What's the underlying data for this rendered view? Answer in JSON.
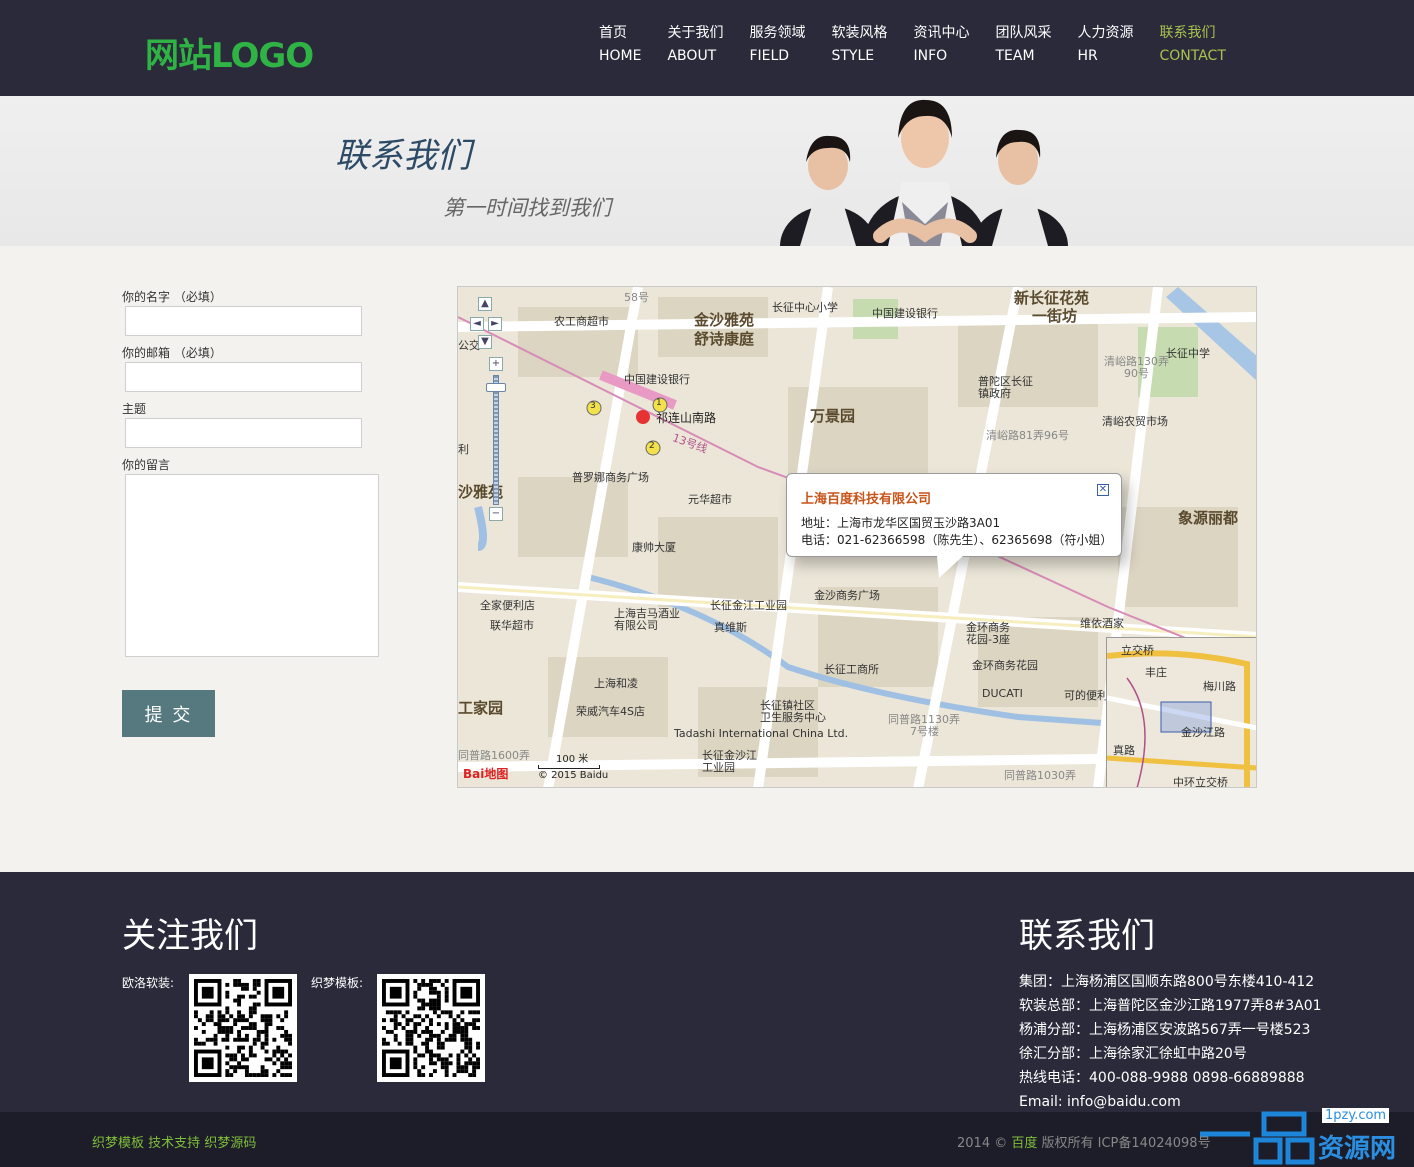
{
  "header": {
    "logo": "网站LOGO",
    "nav": [
      {
        "cn": "首页",
        "en": "HOME"
      },
      {
        "cn": "关于我们",
        "en": "ABOUT"
      },
      {
        "cn": "服务领域",
        "en": "FIELD"
      },
      {
        "cn": "软装风格",
        "en": "STYLE"
      },
      {
        "cn": "资讯中心",
        "en": "INFO"
      },
      {
        "cn": "团队风采",
        "en": "TEAM"
      },
      {
        "cn": "人力资源",
        "en": "HR"
      },
      {
        "cn": "联系我们",
        "en": "CONTACT"
      }
    ],
    "active_index": 7,
    "colors": {
      "bg": "#2b2a3b",
      "logo": "#2fb344",
      "active": "#a7c34c"
    }
  },
  "banner": {
    "title": "联系我们",
    "subtitle": "第一时间找到我们"
  },
  "form": {
    "name_label": "你的名字 （必填）",
    "email_label": "你的邮箱 （必填）",
    "subject_label": "主题",
    "message_label": "你的留言",
    "name_value": "",
    "email_value": "",
    "subject_value": "",
    "message_value": "",
    "submit_label": "提 交",
    "submit_color": "#55797f"
  },
  "map": {
    "popup": {
      "title": "上海百度科技有限公司",
      "address": "地址：上海市龙华区国贸玉沙路3A01",
      "phone": "电话：021-62366598（陈先生）、62365698（符小姐）"
    },
    "labels": {
      "l1": "金沙雅苑",
      "l2": "舒诗康庭",
      "l3": "万景园",
      "l4": "新长征花苑",
      "l5": "一街坊",
      "l6": "象源丽都",
      "l7": "祁连山南路",
      "l8": "中国建设银行",
      "l9": "长征中心小学",
      "l10": "农工商超市",
      "l11": "普罗娜商务广场",
      "l12": "元华超市",
      "l13": "康帅大厦",
      "l14": "全家便利店",
      "l15": "联华超市",
      "l16": "长征金江工业园",
      "l17": "真维斯",
      "l18": "金沙商务广场",
      "l19": "维依酒家",
      "l20": "金环商务花园",
      "l21": "长征工商所",
      "l22": "上海和凌",
      "l23": "荣威汽车4S店",
      "l24": "Tadashi International China Ltd.",
      "l25": "长征镇社区",
      "l26": "卫生服务中心",
      "l27": "DUCATI",
      "l28": "清峪农贸市场",
      "l29": "长征中学",
      "l30": "普陀区长征",
      "l31": "镇政府",
      "l32": "工家园",
      "l33": "沙雅苑",
      "l34": "上海吉马酒业",
      "l35": "有限公司",
      "l36": "长征金沙江",
      "l37": "工业园",
      "l38": "金环商务",
      "l39": "花园-3座",
      "l40": "清峪路130弄",
      "l41": "90号",
      "l42": "清峪路81弄96号",
      "l43": "同普路1130弄",
      "l44": "7号楼",
      "l45": "同普路1600弄",
      "l46": "同普路1030弄",
      "l47": "可的便利",
      "l48": "中国建设银行",
      "l49": "58号",
      "l50": "公交",
      "l51": "利",
      "l52": "13号线"
    },
    "scale": "100 米",
    "baidu_logo": "Bai地图",
    "copyright": "© 2015 Baidu",
    "minimap": {
      "m1": "丰庄",
      "m2": "梅川路",
      "m3": "金沙江路",
      "m4": "中环立交桥",
      "m5": "真路",
      "m6": "立交桥"
    },
    "markers": {
      "m1": "1",
      "m2": "2",
      "m3": "3"
    }
  },
  "footer": {
    "follow_title": "关注我们",
    "qr1_label": "欧洛软装:",
    "qr2_label": "织梦模板:",
    "contact_title": "联系我们",
    "contact_lines": [
      "集团：上海杨浦区国顺东路800号东楼410-412",
      "软装总部：上海普陀区金沙江路1977弄8#3A01",
      "杨浦分部：上海杨浦区安波路567弄一号楼523",
      "徐汇分部：上海徐家汇徐虹中路20号",
      "热线电话：400-088-9988 0898-66889888",
      "Email: info@baidu.com"
    ]
  },
  "bottom": {
    "links": [
      "织梦模板",
      "技术支持",
      "织梦源码"
    ],
    "copyright_prefix": "2014 ©",
    "copyright_brand": "百度",
    "copyright_suffix": "版权所有 ICP备14024098号"
  },
  "watermark": {
    "domain": "1pzy.com",
    "text": "资源网"
  }
}
